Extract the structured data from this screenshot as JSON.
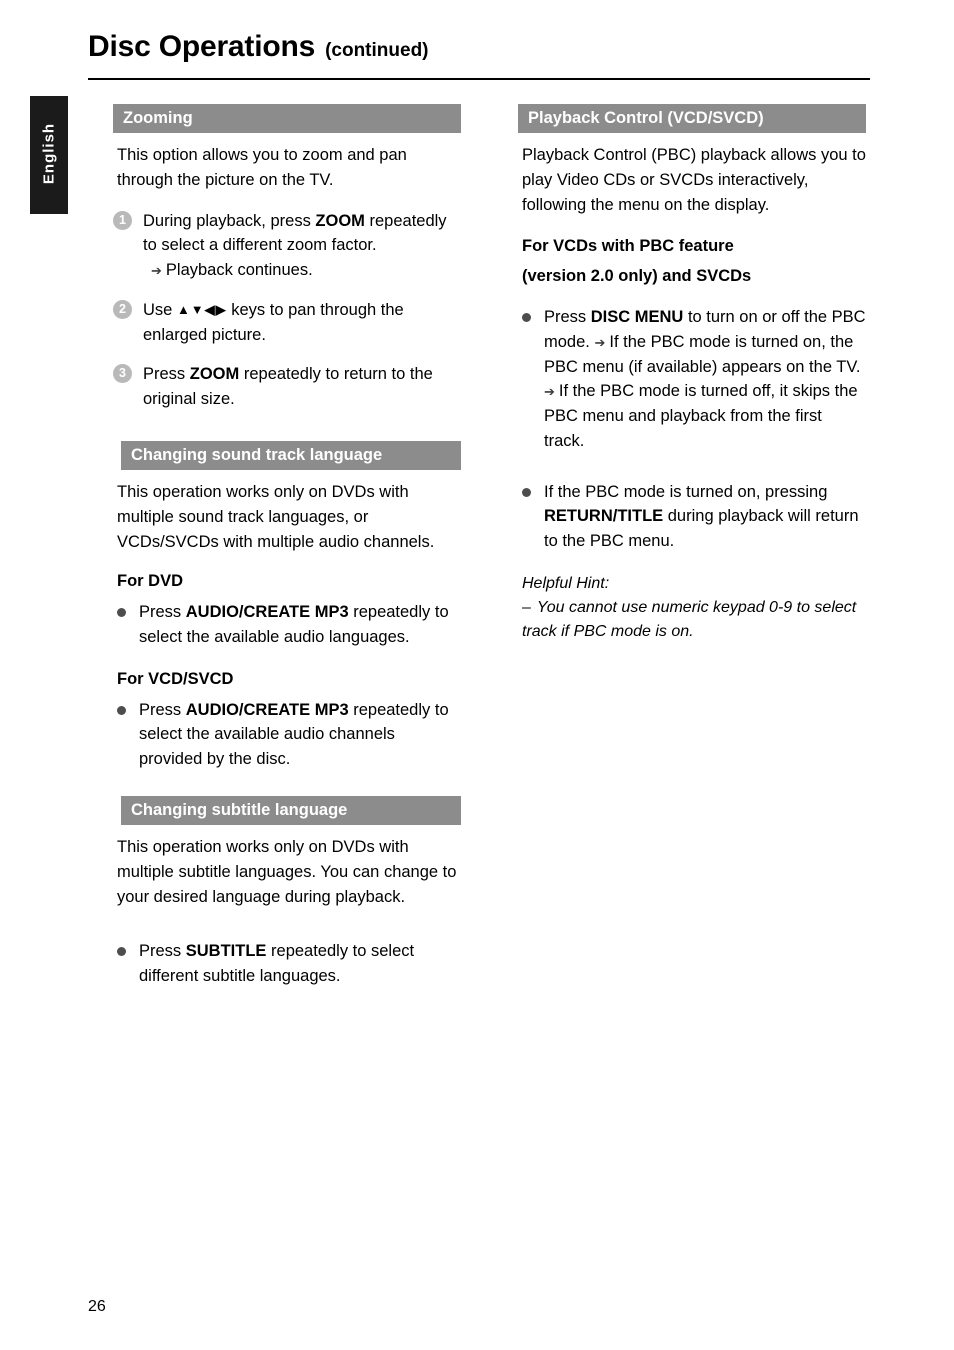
{
  "header": {
    "title": "Disc Operations",
    "subtitle": "(continued)"
  },
  "side_tab": {
    "label": "English"
  },
  "footer": {
    "page_number": "26"
  },
  "left_column": {
    "zooming": {
      "heading": "Zooming",
      "intro": "This option allows you to zoom and pan through the picture on the TV.",
      "steps": [
        {
          "num": "1",
          "text_before": "During playback, press ",
          "keyword": "ZOOM",
          "text_after": " repeatedly to select a different zoom factor.",
          "arrow": "➔",
          "arrow_text": "Playback continues."
        },
        {
          "num": "2",
          "text_before": "Use ",
          "keys": "▲▼◀▶",
          "text_after": " keys to pan through the enlarged picture."
        },
        {
          "num": "3",
          "text_before": "Press ",
          "keyword": "ZOOM",
          "text_after": " repeatedly to return to the original size."
        }
      ]
    },
    "sound_track": {
      "heading": "Changing sound track language",
      "intro": "This operation works only on DVDs with multiple sound track languages, or VCDs/SVCDs with multiple audio channels.",
      "dvd_head": "For DVD",
      "dvd_bullet": {
        "text_before": "Press ",
        "keyword": "AUDIO/CREATE MP3",
        "text_after": " repeatedly to select the available audio languages."
      },
      "vcd_head": "For VCD/SVCD",
      "vcd_bullet": {
        "text_before": "Press ",
        "keyword": "AUDIO/CREATE MP3",
        "text_after": " repeatedly to select the available audio channels provided by the disc."
      }
    },
    "subtitle_section": {
      "heading": "Changing subtitle language",
      "intro": "This operation works only on DVDs with multiple subtitle languages. You can change to your desired language during playback.",
      "bullet": {
        "text_before": "Press ",
        "keyword": "SUBTITLE",
        "text_after": " repeatedly to select different subtitle languages."
      }
    }
  },
  "right_column": {
    "pbc": {
      "heading": "Playback Control (VCD/SVCD)",
      "intro": "Playback Control (PBC) playback allows you to play Video CDs or SVCDs interactively, following the menu on the display.",
      "sub_head_line1": "For VCDs with PBC feature",
      "sub_head_line2": "(version 2.0 only) and SVCDs",
      "bullet1": {
        "text_before": "Press ",
        "keyword": "DISC MENU",
        "text_after": " to turn on or off the PBC mode.",
        "arrow": "➔",
        "arrow_text_1": "If the PBC mode is turned on, the PBC menu (if available) appears on the TV.",
        "arrow_text_2": "If the PBC mode is turned off, it skips the PBC menu and playback from the first track."
      },
      "bullet2": {
        "text_before": "If the PBC mode is turned on, pressing ",
        "keyword": "RETURN/TITLE",
        "text_after": " during playback will return to the PBC menu."
      },
      "hint_label": "Helpful Hint:",
      "hint_dash": "–",
      "hint_text": "You cannot use numeric keypad 0-9 to select track if PBC mode is on."
    }
  }
}
